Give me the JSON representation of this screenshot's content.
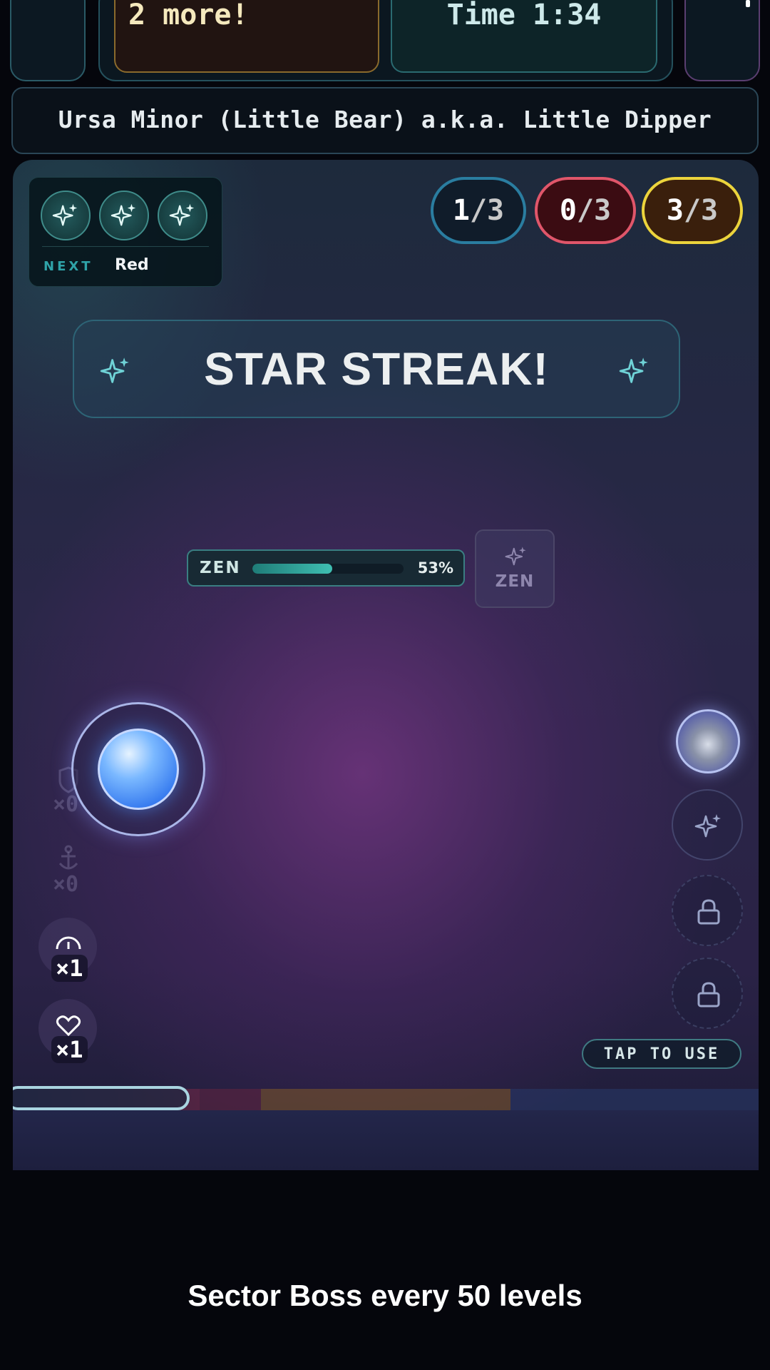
{
  "hud": {
    "counter_text": "2 more!",
    "timer_text": "Time 1:34"
  },
  "constellation_banner": "Ursa Minor (Little Bear) a.k.a. Little Dipper",
  "combo_card": {
    "stars": [
      "sparkle-icon",
      "sparkle-icon",
      "sparkle-icon"
    ],
    "next_label": "NEXT",
    "next_value": "Red"
  },
  "pills": [
    {
      "num": "1",
      "den": "/3",
      "color": "#2a7da0"
    },
    {
      "num": "0",
      "den": "/3",
      "color": "#e0566a"
    },
    {
      "num": "3",
      "den": "/3",
      "color": "#ecd43c"
    }
  ],
  "streak_text": "STAR STREAK!",
  "zen": {
    "label": "ZEN",
    "percent_text": "53%",
    "percent": 0.53,
    "button_label": "ZEN"
  },
  "powerups": [
    {
      "icon": "shield-icon",
      "count": "×0",
      "active": false
    },
    {
      "icon": "anchor-icon",
      "count": "×0",
      "active": false
    },
    {
      "icon": "gauge-icon",
      "count": "×1",
      "active": true
    },
    {
      "icon": "heart-icon",
      "count": "×1",
      "active": true
    }
  ],
  "right_buttons": [
    "moon-orb-icon",
    "sparkle-icon",
    "lock-icon",
    "lock-icon"
  ],
  "tap_to_use": "TAP TO USE",
  "caption": "Sector Boss every 50 levels"
}
